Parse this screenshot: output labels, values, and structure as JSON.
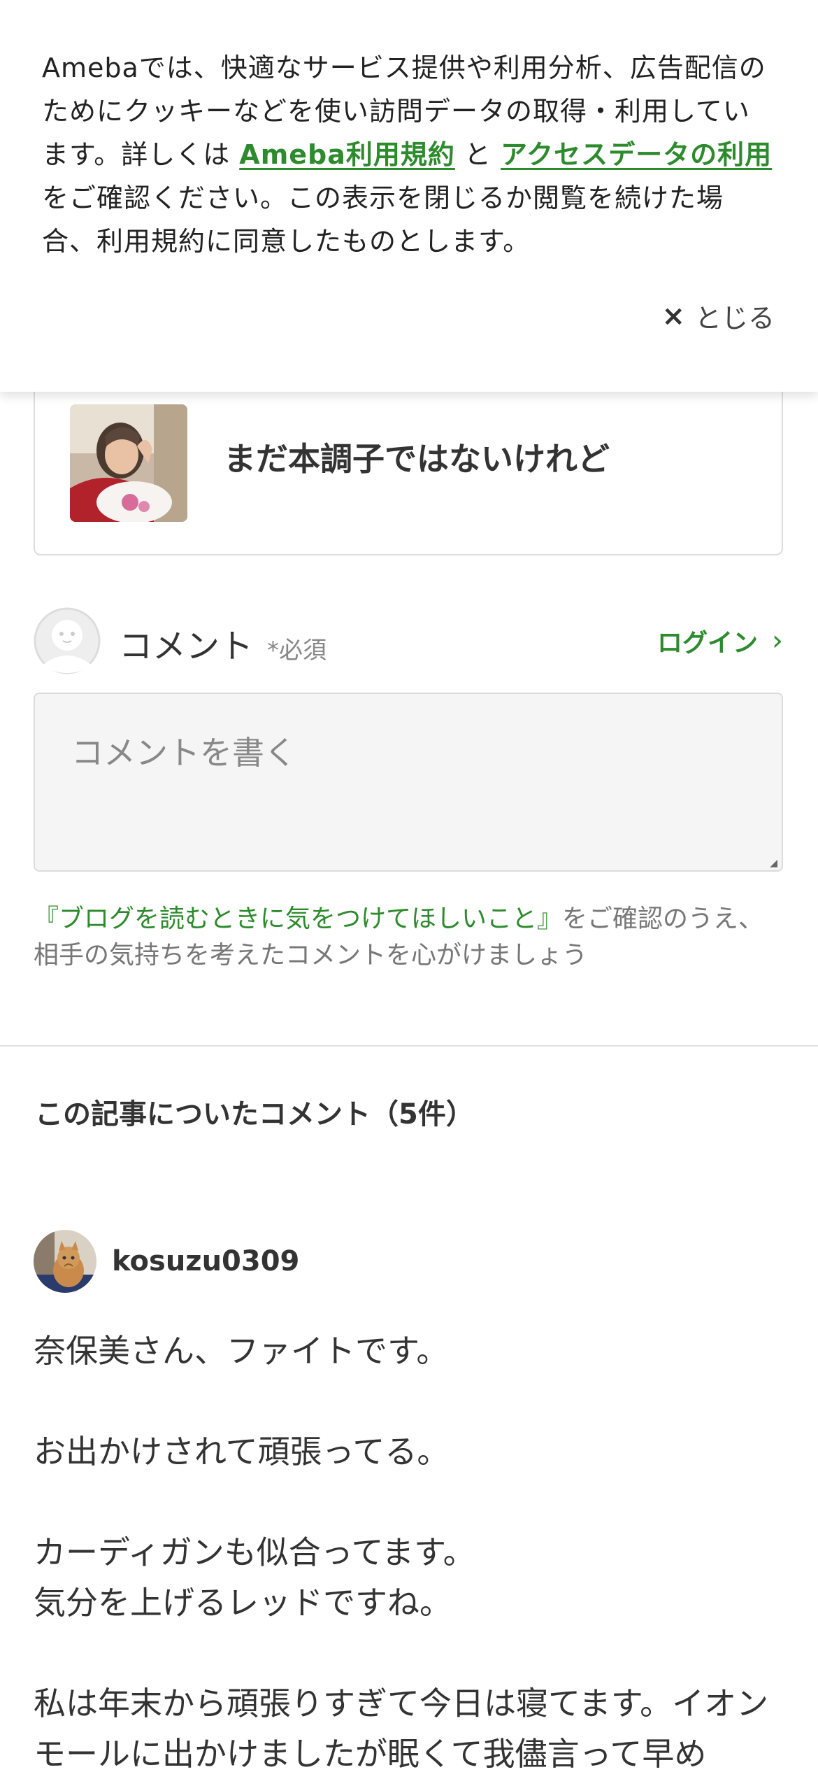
{
  "cookie_banner": {
    "text_before": "Amebaでは、快適なサービス提供や利用分析、広告配信のためにクッキーなどを使い訪問データの取得・利用しています。詳しくは ",
    "terms_link": "Ameba利用規約",
    "text_middle": " と ",
    "access_link": "アクセスデータの利用",
    "text_after": " をご確認ください。この表示を閉じるか閲覧を続けた場合、利用規約に同意したものとします。",
    "close_icon": "×",
    "close_label": "とじる"
  },
  "article": {
    "title": "まだ本調子ではないけれど"
  },
  "comment_form": {
    "label": "コメント",
    "required": "*必須",
    "login": "ログイン",
    "login_chevron": "›",
    "placeholder": "コメントを書く",
    "notice_link": "『ブログを読むときに気をつけてほしいこと』",
    "notice_text": "をご確認のうえ、相手の気持ちを考えたコメントを心がけましょう"
  },
  "comments": {
    "heading": "この記事についたコメント（5件）",
    "items": [
      {
        "user": "kosuzu0309",
        "paragraphs": [
          "奈保美さん、ファイトです。",
          "お出かけされて頑張ってる。",
          "カーディガンも似合ってます。\n気分を上げるレッドですね。",
          "私は年末から頑張りすぎて今日は寝てます。イオンモールに出かけましたが眠くて我儘言って早め"
        ]
      }
    ]
  },
  "colors": {
    "accent_green": "#2d8a2d",
    "text": "#333333",
    "muted": "#888888"
  }
}
